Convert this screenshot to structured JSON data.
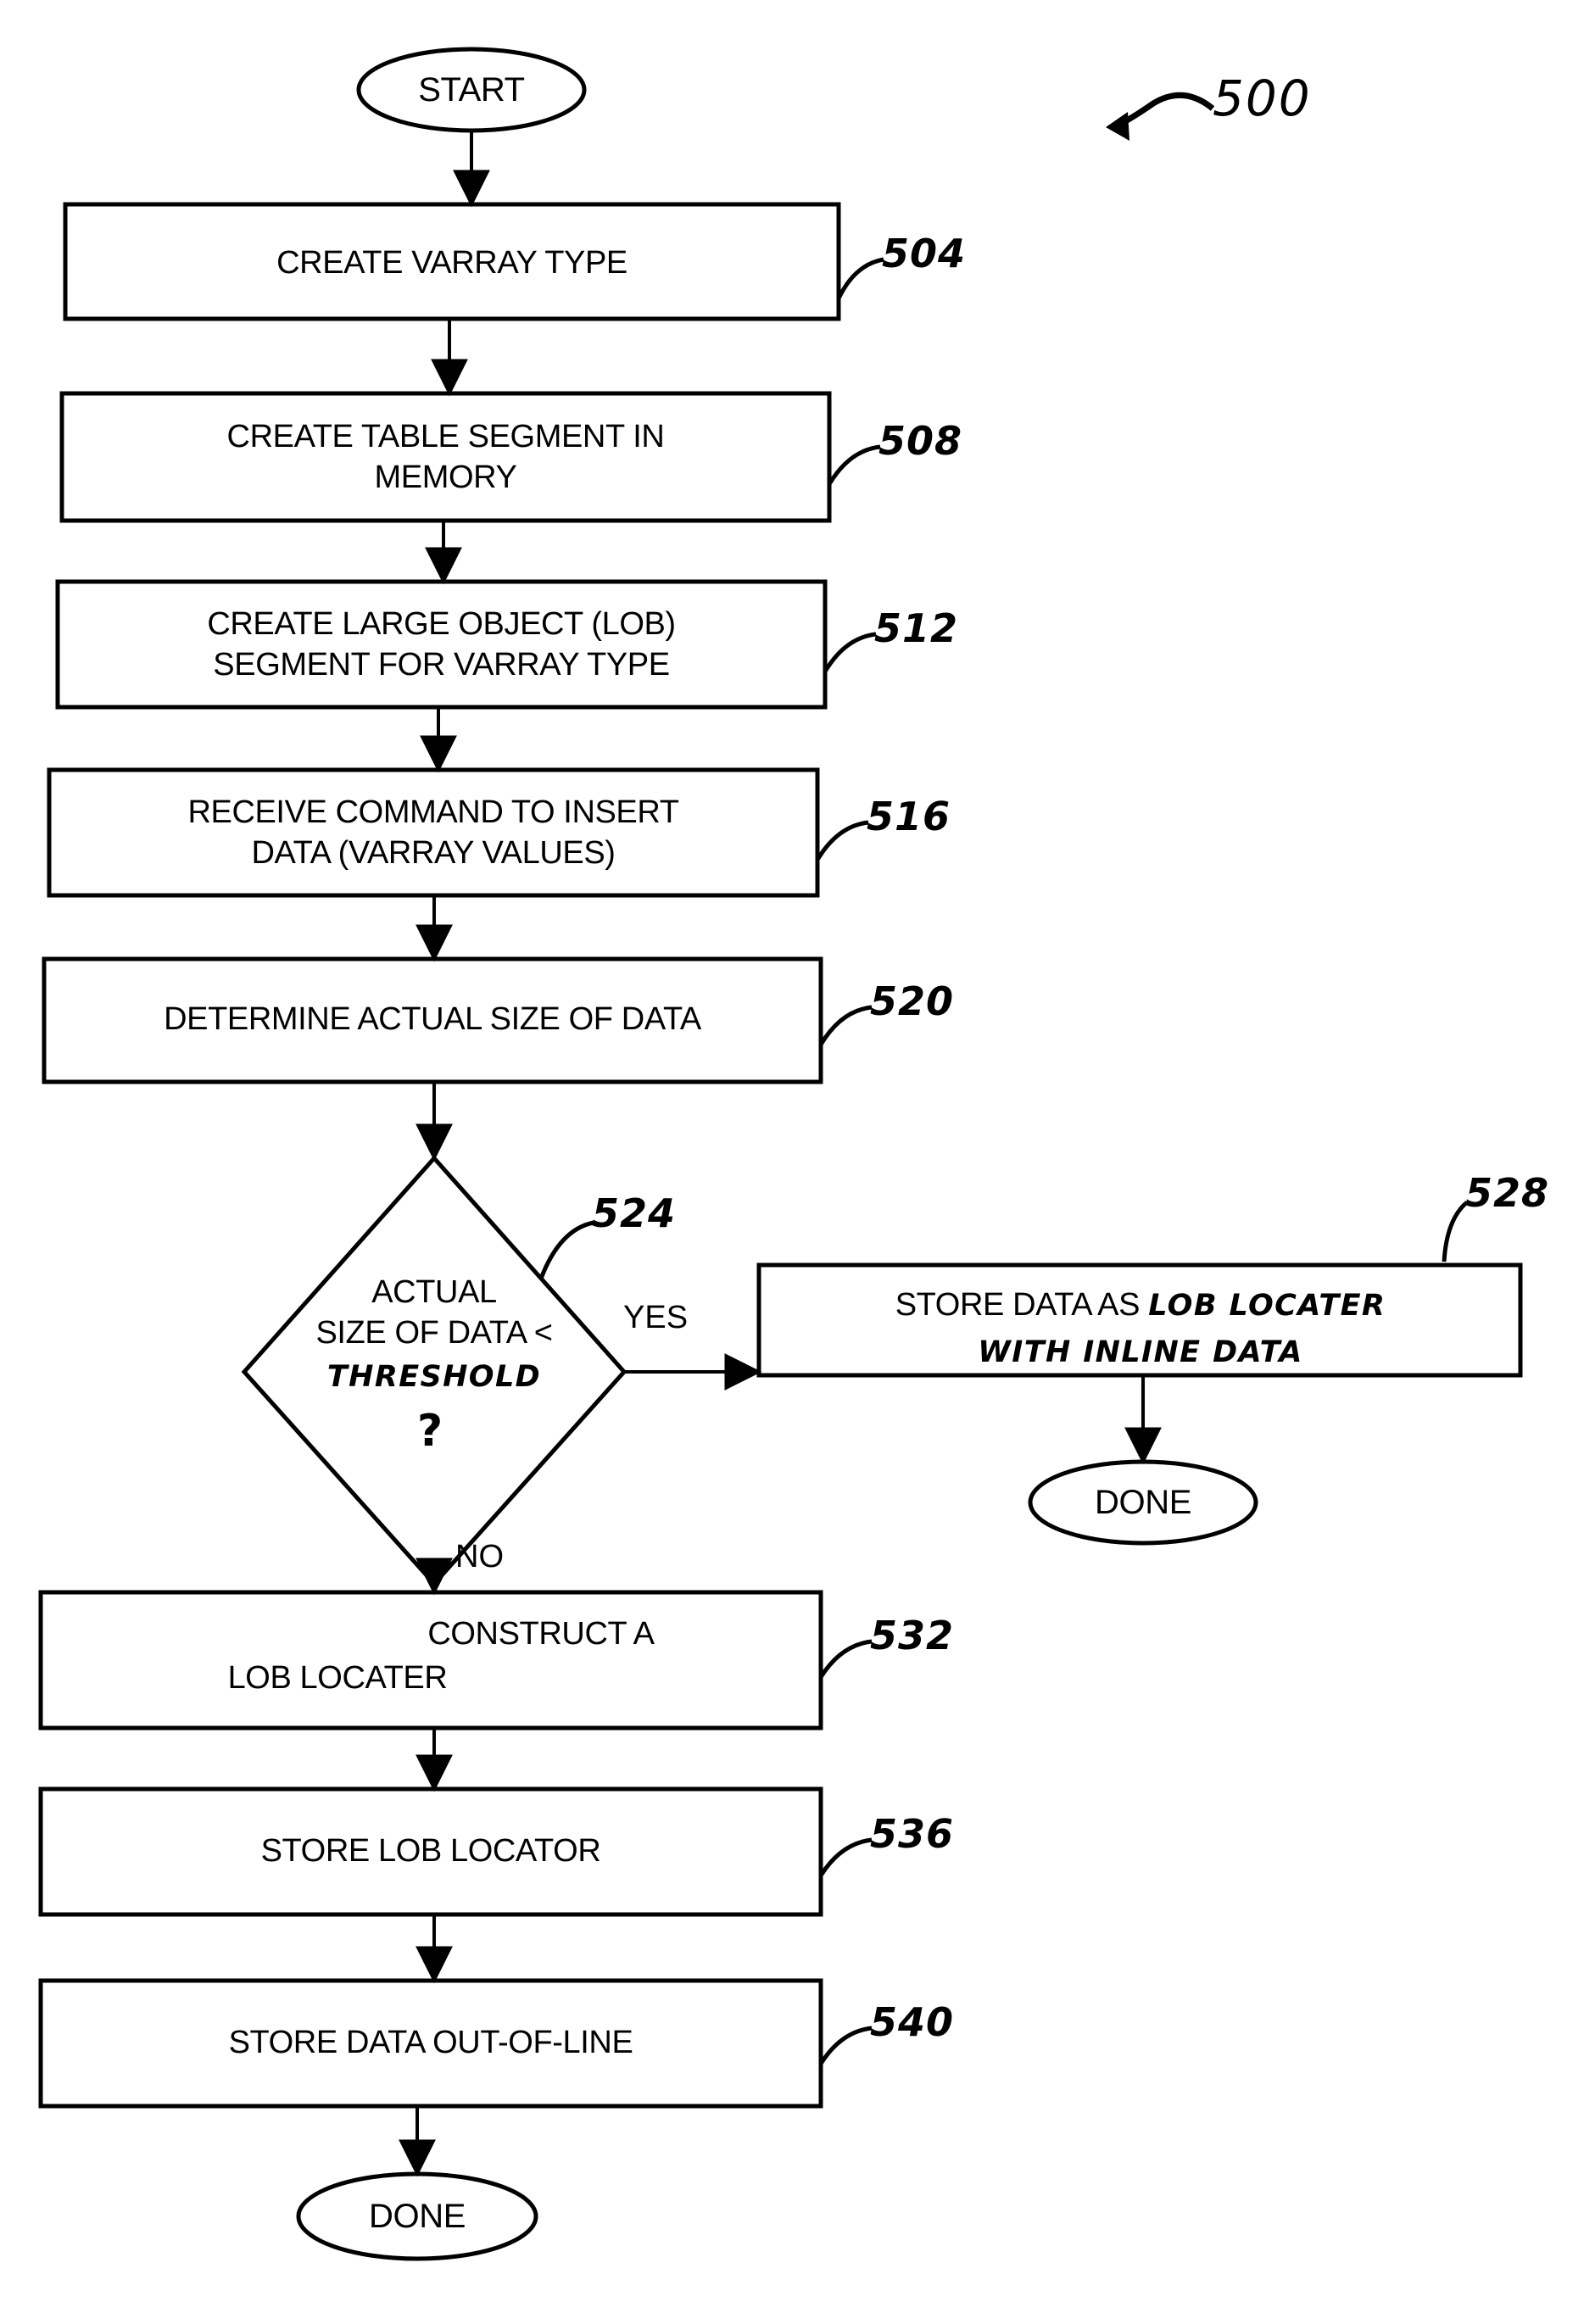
{
  "figure": {
    "number": "500",
    "title": "START"
  },
  "nodes": {
    "start": {
      "label": "START",
      "shape": "terminator"
    },
    "n504": {
      "label": "CREATE VARRAY TYPE",
      "ref": "504",
      "shape": "process"
    },
    "n508": {
      "label": "CREATE TABLE SEGMENT IN\nMEMORY",
      "ref": "508",
      "shape": "process"
    },
    "n512": {
      "label": "CREATE LARGE OBJECT (LOB)\nSEGMENT FOR VARRAY TYPE",
      "ref": "512",
      "shape": "process"
    },
    "n516": {
      "label": "RECEIVE COMMAND TO INSERT\nDATA (VARRAY VALUES)",
      "ref": "516",
      "shape": "process"
    },
    "n520": {
      "label": "DETERMINE ACTUAL SIZE OF DATA",
      "ref": "520",
      "shape": "process"
    },
    "n524": {
      "line1": "ACTUAL",
      "line2": "SIZE OF DATA <",
      "line3_handwritten": "THRESHOLD",
      "line4": "?",
      "ref": "524",
      "shape": "decision"
    },
    "n528": {
      "printed": "STORE DATA AS ",
      "handwritten_line1": "LOB LOCATER",
      "handwritten_line2": "WITH INLINE DATA",
      "ref": "528",
      "shape": "process"
    },
    "done_yes": {
      "label": "DONE",
      "shape": "terminator"
    },
    "n532": {
      "line1": "CONSTRUCT A",
      "line2": "LOB LOCATER",
      "ref": "532",
      "shape": "process"
    },
    "n536": {
      "label": "STORE LOB LOCATOR",
      "ref": "536",
      "shape": "process"
    },
    "n540": {
      "label": "STORE DATA OUT-OF-LINE",
      "ref": "540",
      "shape": "process"
    },
    "done_no": {
      "label": "DONE",
      "shape": "terminator"
    }
  },
  "edges": {
    "yes_label": "YES",
    "no_label": "NO"
  },
  "colors": {
    "stroke": "#000000",
    "fill": "#ffffff",
    "text": "#000000"
  }
}
